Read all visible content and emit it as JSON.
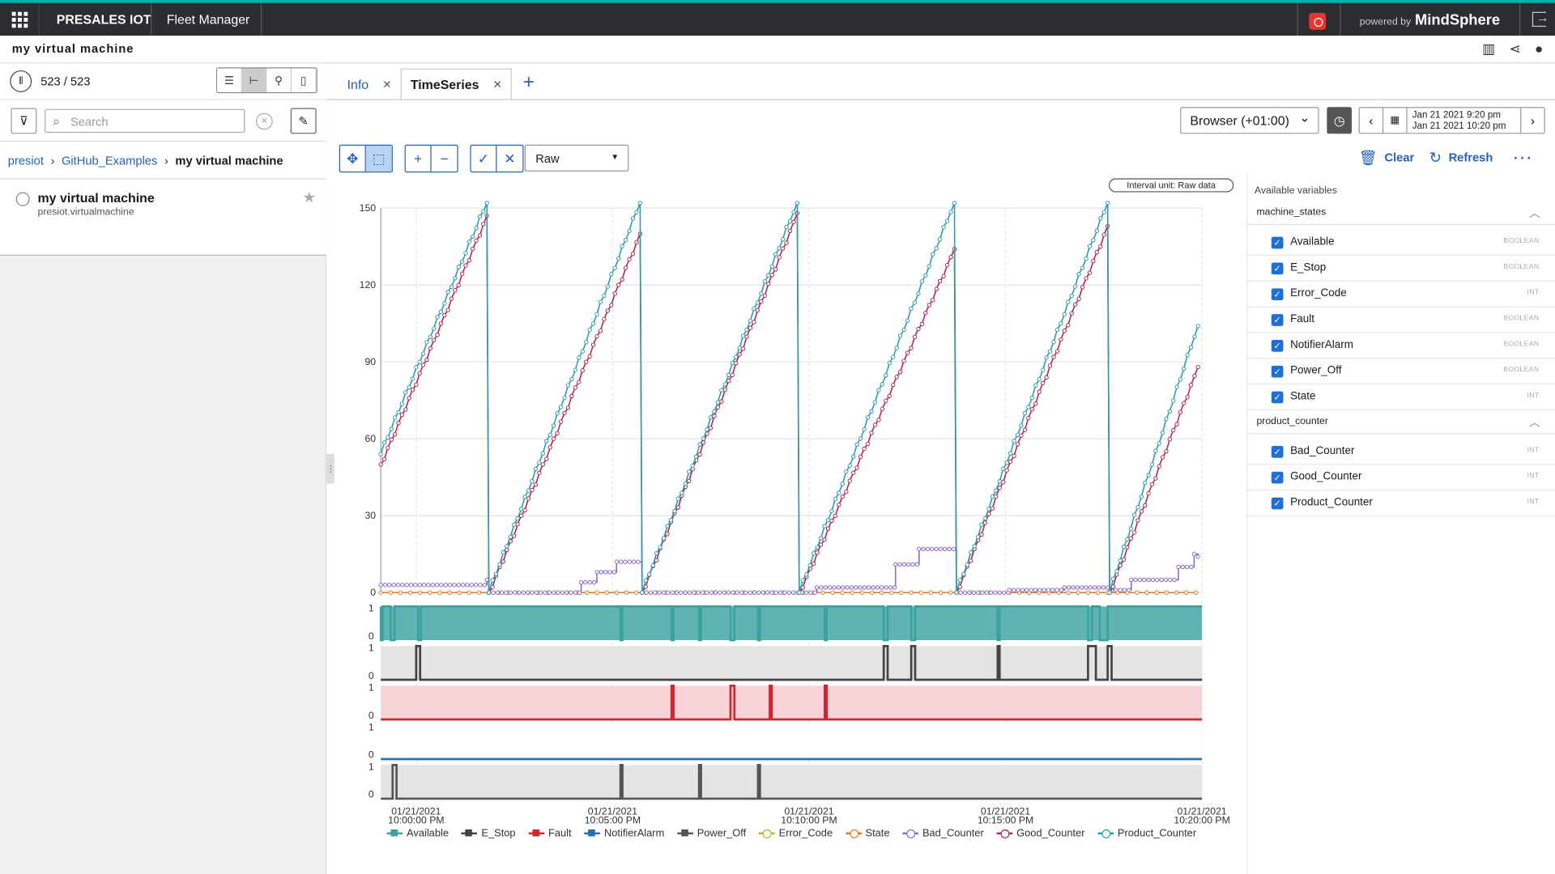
{
  "topbar": {
    "brand": "PRESALES IOT",
    "app_name": "Fleet Manager",
    "powered_prefix": "powered by",
    "powered_brand": "MindSphere"
  },
  "asset_header": {
    "title": "my virtual machine"
  },
  "sidebar": {
    "count": "523 / 523",
    "search_placeholder": "Search",
    "breadcrumb": [
      "presiot",
      "GitHub_Examples",
      "my virtual machine"
    ],
    "asset": {
      "name": "my virtual machine",
      "type": "presiot.virtualmachine"
    }
  },
  "tabs": [
    {
      "label": "Info",
      "active": false
    },
    {
      "label": "TimeSeries",
      "active": true
    }
  ],
  "toolbar": {
    "timezone": "Browser (+01:00)",
    "range_from": "Jan 21 2021 9:20 pm",
    "range_to": "Jan 21 2021 10:20 pm",
    "mode": "Raw",
    "clear": "Clear",
    "refresh": "Refresh",
    "interval_badge": "Interval unit: Raw data"
  },
  "variables": {
    "title": "Available variables",
    "groups": [
      {
        "name": "machine_states",
        "items": [
          {
            "name": "Available",
            "type": "BOOLEAN"
          },
          {
            "name": "E_Stop",
            "type": "BOOLEAN"
          },
          {
            "name": "Error_Code",
            "type": "INT"
          },
          {
            "name": "Fault",
            "type": "BOOLEAN"
          },
          {
            "name": "NotifierAlarm",
            "type": "BOOLEAN"
          },
          {
            "name": "Power_Off",
            "type": "BOOLEAN"
          },
          {
            "name": "State",
            "type": "INT"
          }
        ]
      },
      {
        "name": "product_counter",
        "items": [
          {
            "name": "Bad_Counter",
            "type": "INT"
          },
          {
            "name": "Good_Counter",
            "type": "INT"
          },
          {
            "name": "Product_Counter",
            "type": "INT"
          }
        ]
      }
    ]
  },
  "chart_data": {
    "type": "line",
    "x_tick_labels": [
      [
        "01/21/2021",
        "10:00:00 PM"
      ],
      [
        "01/21/2021",
        "10:05:00 PM"
      ],
      [
        "01/21/2021",
        "10:10:00 PM"
      ],
      [
        "01/21/2021",
        "10:15:00 PM"
      ],
      [
        "01/21/2021",
        "10:20:00 PM"
      ]
    ],
    "x_ticks_min": [
      0,
      5,
      10,
      15,
      20
    ],
    "x_range_min": [
      -0.9,
      20
    ],
    "y_ticks": [
      0,
      30,
      60,
      90,
      120,
      150
    ],
    "ylim": [
      0,
      150
    ],
    "series_colors": {
      "Available": "#3aa3a0",
      "E_Stop": "#444444",
      "Fault": "#d0262f",
      "NotifierAlarm": "#2a6eb8",
      "Power_Off": "#555555",
      "Error_Code": "#b8b430",
      "State": "#e07a2a",
      "Bad_Counter": "#8a6bc6",
      "Good_Counter": "#b0284e",
      "Product_Counter": "#2e9bb0"
    },
    "product_counter_cycles": [
      [
        -0.9,
        54
      ],
      [
        1.8,
        152
      ],
      [
        1.85,
        0
      ],
      [
        5.7,
        152
      ],
      [
        5.75,
        0
      ],
      [
        9.7,
        152
      ],
      [
        9.75,
        0
      ],
      [
        13.7,
        152
      ],
      [
        13.75,
        0
      ],
      [
        17.6,
        152
      ],
      [
        17.65,
        0
      ],
      [
        19.9,
        104
      ]
    ],
    "good_counter_cycles": [
      [
        -0.9,
        50
      ],
      [
        1.8,
        147
      ],
      [
        1.85,
        0
      ],
      [
        5.7,
        140
      ],
      [
        5.75,
        0
      ],
      [
        9.7,
        148
      ],
      [
        9.75,
        0
      ],
      [
        13.7,
        134
      ],
      [
        13.75,
        0
      ],
      [
        17.6,
        143
      ],
      [
        17.65,
        0
      ],
      [
        19.9,
        88
      ]
    ],
    "bad_counter_steps": [
      [
        -0.9,
        3
      ],
      [
        1.8,
        5
      ],
      [
        1.85,
        0
      ],
      [
        4.2,
        4
      ],
      [
        4.6,
        8
      ],
      [
        5.1,
        12
      ],
      [
        5.75,
        0
      ],
      [
        10.2,
        2
      ],
      [
        12.2,
        11
      ],
      [
        12.8,
        17
      ],
      [
        13.75,
        0
      ],
      [
        15.1,
        1
      ],
      [
        16.5,
        2
      ],
      [
        17.7,
        1
      ],
      [
        18.2,
        5
      ],
      [
        19.4,
        10
      ],
      [
        19.8,
        15
      ],
      [
        19.9,
        14
      ]
    ],
    "state_value": 0,
    "binary_rows": [
      {
        "label": "Available",
        "fill": "#5fb3b1",
        "base": 1,
        "dips": [
          [
            -0.9,
            -0.85
          ],
          [
            -0.65,
            -0.55
          ],
          [
            0.05,
            0.12
          ],
          [
            5.2,
            5.25
          ],
          [
            6.5,
            6.55
          ],
          [
            7.2,
            7.25
          ],
          [
            8.0,
            8.1
          ],
          [
            8.7,
            8.75
          ],
          [
            10.4,
            10.45
          ],
          [
            11.9,
            12.0
          ],
          [
            12.6,
            12.7
          ],
          [
            14.8,
            14.85
          ],
          [
            17.1,
            17.2
          ],
          [
            17.4,
            17.6
          ]
        ]
      },
      {
        "label": "E_Stop",
        "fill": "#e4e4e4",
        "base": 0,
        "spikes": [
          [
            0.0,
            0.1
          ],
          [
            11.9,
            12.0
          ],
          [
            12.6,
            12.7
          ],
          [
            14.8,
            14.85
          ],
          [
            17.1,
            17.3
          ],
          [
            17.6,
            17.7
          ]
        ]
      },
      {
        "label": "Fault",
        "fill": "#f8d4d8",
        "base": 0,
        "spikes": [
          [
            6.5,
            6.55
          ],
          [
            8.0,
            8.1
          ],
          [
            9.0,
            9.05
          ],
          [
            10.4,
            10.45
          ]
        ]
      },
      {
        "label": "NotifierAlarm",
        "fill": "#ffffff",
        "base": 0,
        "spikes": []
      },
      {
        "label": "Power_Off",
        "fill": "#e4e4e4",
        "base": 0,
        "spikes": [
          [
            -0.6,
            -0.5
          ],
          [
            5.2,
            5.25
          ],
          [
            7.2,
            7.25
          ],
          [
            8.7,
            8.75
          ]
        ]
      }
    ],
    "legend": [
      "Available",
      "E_Stop",
      "Fault",
      "NotifierAlarm",
      "Power_Off",
      "Error_Code",
      "State",
      "Bad_Counter",
      "Good_Counter",
      "Product_Counter"
    ],
    "legend_markers": {
      "Available": "square",
      "E_Stop": "square",
      "Fault": "square",
      "NotifierAlarm": "square",
      "Power_Off": "square",
      "Error_Code": "circle",
      "State": "circle",
      "Bad_Counter": "circle",
      "Good_Counter": "circle",
      "Product_Counter": "circle"
    }
  }
}
